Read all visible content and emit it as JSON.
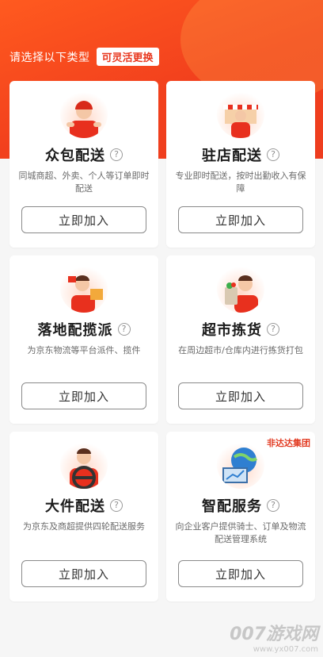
{
  "header": {
    "prompt": "请选择以下类型",
    "badge": "可灵活更换"
  },
  "cards": [
    {
      "title": "众包配送",
      "desc": "同城商超、外卖、个人等订单即时配送",
      "button": "立即加入",
      "icon": "courier-helmet-icon"
    },
    {
      "title": "驻店配送",
      "desc": "专业即时配送，按时出勤收入有保障",
      "button": "立即加入",
      "icon": "storefront-courier-icon"
    },
    {
      "title": "落地配揽派",
      "desc": "为京东物流等平台派件、揽件",
      "button": "立即加入",
      "icon": "parcel-courier-icon"
    },
    {
      "title": "超市拣货",
      "desc": "在周边超市/仓库内进行拣货打包",
      "button": "立即加入",
      "icon": "grocery-bag-icon"
    },
    {
      "title": "大件配送",
      "desc": "为京东及商超提供四轮配送服务",
      "button": "立即加入",
      "icon": "steering-wheel-icon"
    },
    {
      "title": "智配服务",
      "desc": "向企业客户提供骑士、订单及物流配送管理系统",
      "button": "立即加入",
      "icon": "globe-computer-icon",
      "tag": "非达达集团"
    }
  ],
  "help_glyph": "?",
  "watermark": {
    "main": "007游戏网",
    "url": "www.yx007.com"
  },
  "colors": {
    "brand": "#f2401d",
    "accent_text": "#e8381f"
  }
}
